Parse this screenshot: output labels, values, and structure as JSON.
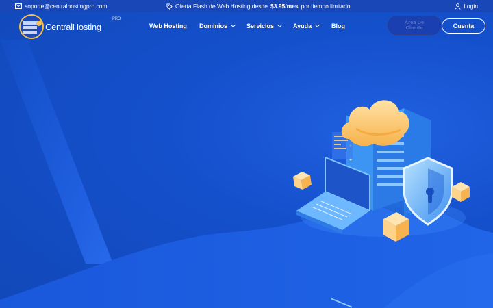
{
  "topbar": {
    "email": "soporte@centralhostingpro.com",
    "promo_prefix": "Oferta Flash de Web Hosting desde",
    "promo_price": "$3.95/mes",
    "promo_suffix": "por tiempo limitado",
    "login": "Login"
  },
  "logo": {
    "name": "CentralHosting",
    "badge": "PRO"
  },
  "nav": {
    "items": [
      {
        "label": "Web Hosting"
      },
      {
        "label": "Dominios"
      },
      {
        "label": "Servicios"
      },
      {
        "label": "Ayuda"
      },
      {
        "label": "Blog"
      }
    ],
    "client_area": "Área De Cliente",
    "account": "Cuenta"
  },
  "colors": {
    "background": "#1552c9",
    "topbar": "#1a47b8",
    "wave": "#1e5fe3",
    "cloud": "#ffc46a",
    "cube": "#ffd38a"
  }
}
